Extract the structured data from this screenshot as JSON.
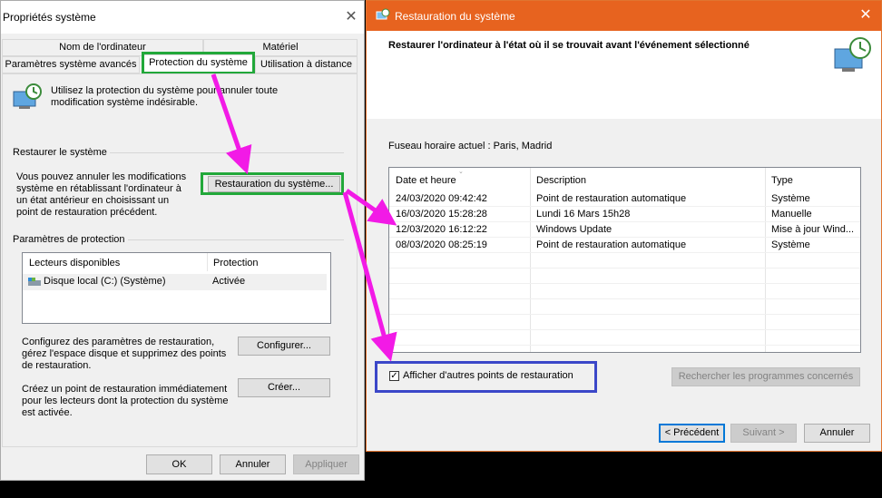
{
  "left_window": {
    "title": "Propriétés système",
    "tabs_row1": [
      "Nom de l'ordinateur",
      "Matériel"
    ],
    "tabs_row2": [
      "Paramètres système avancés",
      "Protection du système",
      "Utilisation à distance"
    ],
    "intro_text": "Utilisez la protection du système pour annuler toute modification système indésirable.",
    "restore_group": "Restaurer le système",
    "restore_desc": "Vous pouvez annuler les modifications système en rétablissant l'ordinateur à un état antérieur en choisissant un point de restauration précédent.",
    "restore_button": "Restauration du système...",
    "protection_group": "Paramètres de protection",
    "drives_header": [
      "Lecteurs disponibles",
      "Protection"
    ],
    "drives": [
      {
        "name": "Disque local (C:) (Système)",
        "protection": "Activée"
      }
    ],
    "configure_desc": "Configurez des paramètres de restauration, gérez l'espace disque et supprimez des points de restauration.",
    "configure_button": "Configurer...",
    "create_desc": "Créez un point de restauration immédiatement pour les lecteurs dont la protection du système est activée.",
    "create_button": "Créer...",
    "ok_button": "OK",
    "cancel_button": "Annuler",
    "apply_button": "Appliquer"
  },
  "right_window": {
    "title": "Restauration du système",
    "header_text": "Restaurer l'ordinateur à l'état où il se trouvait avant l'événement sélectionné",
    "timezone": "Fuseau horaire actuel : Paris, Madrid",
    "columns": [
      "Date et heure",
      "Description",
      "Type"
    ],
    "rows": [
      {
        "date": "24/03/2020 09:42:42",
        "description": "Point de restauration automatique",
        "type": "Système"
      },
      {
        "date": "16/03/2020 15:28:28",
        "description": "Lundi 16 Mars 15h28",
        "type": "Manuelle"
      },
      {
        "date": "12/03/2020 16:12:22",
        "description": "Windows Update",
        "type": "Mise à jour Wind..."
      },
      {
        "date": "08/03/2020 08:25:19",
        "description": "Point de restauration automatique",
        "type": "Système"
      }
    ],
    "show_more_label": "Afficher d'autres points de restauration",
    "show_more_checked": true,
    "scan_button": "Rechercher les programmes concernés",
    "prev_button": "< Précédent",
    "next_button": "Suivant >",
    "cancel_button": "Annuler"
  },
  "colors": {
    "titlebar_orange": "#e7631f",
    "highlight_green": "#22a83a",
    "highlight_blue": "#3b47c8",
    "arrow_magenta": "#f21ae6"
  }
}
